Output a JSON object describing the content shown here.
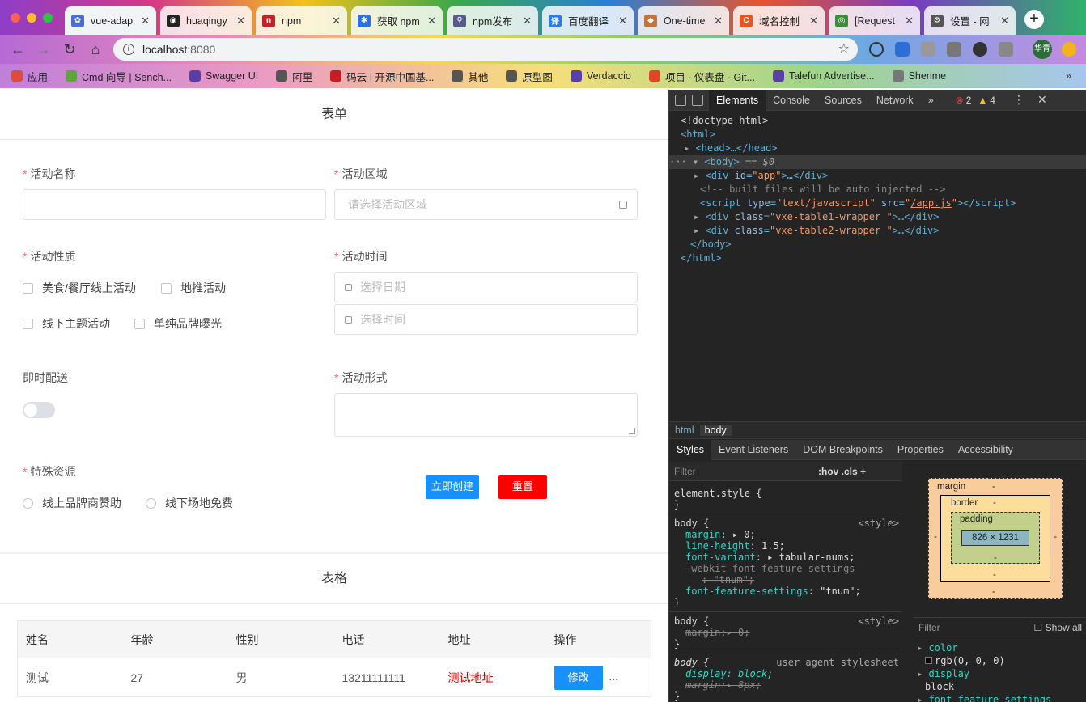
{
  "browser": {
    "tabs": [
      {
        "title": "vue-adap",
        "color": "#4b6cd6",
        "glyph": "✿",
        "active": true
      },
      {
        "title": "huaqingy",
        "color": "#222222",
        "glyph": "◉"
      },
      {
        "title": "npm",
        "color": "#c12127",
        "glyph": "n"
      },
      {
        "title": "获取 npm",
        "color": "#2f6fdb",
        "glyph": "✱"
      },
      {
        "title": "npm发布",
        "color": "#5a5a8a",
        "glyph": "⚲"
      },
      {
        "title": "百度翻译",
        "color": "#2b7be8",
        "glyph": "译"
      },
      {
        "title": "One-time",
        "color": "#c2743a",
        "glyph": "◆"
      },
      {
        "title": "域名控制",
        "color": "#e8531e",
        "glyph": "C"
      },
      {
        "title": "[Request",
        "color": "#3a8e3a",
        "glyph": "◎"
      },
      {
        "title": "设置 - 网",
        "color": "#555555",
        "glyph": "⚙"
      }
    ],
    "new_tab_label": "+",
    "url_host": "localhost",
    "url_port": ":8080",
    "profile_label": "华青",
    "bookmarks": [
      {
        "label": "应用",
        "color": "#e04a3a"
      },
      {
        "label": "Cmd 向导 | Sench...",
        "color": "#5da63a"
      },
      {
        "label": "Swagger UI",
        "color": "#5b3fa8"
      },
      {
        "label": "阿里",
        "color": "#555555"
      },
      {
        "label": "码云 | 开源中国基...",
        "color": "#c71d23"
      },
      {
        "label": "其他",
        "color": "#555555"
      },
      {
        "label": "原型图",
        "color": "#555555"
      },
      {
        "label": "Verdaccio",
        "color": "#5b3fa8"
      },
      {
        "label": "项目 · 仪表盘 · Git...",
        "color": "#e2432a"
      },
      {
        "label": "Talefun Advertise...",
        "color": "#5b3fa8"
      },
      {
        "label": "Shenme",
        "color": "#777777"
      }
    ]
  },
  "form": {
    "title": "表单",
    "activity_name_label": "活动名称",
    "activity_region_label": "活动区域",
    "activity_region_placeholder": "请选择活动区域",
    "activity_type_label": "活动性质",
    "activity_type_options": [
      "美食/餐厅线上活动",
      "地推活动",
      "线下主题活动",
      "单纯品牌曝光"
    ],
    "activity_time_label": "活动时间",
    "date_placeholder": "选择日期",
    "time_placeholder": "选择时间",
    "instant_delivery_label": "即时配送",
    "activity_form_label": "活动形式",
    "special_resource_label": "特殊资源",
    "special_resource_options": [
      "线上品牌商赞助",
      "线下场地免费"
    ],
    "create_button": "立即创建",
    "reset_button": "重置",
    "create_color": "#1890ff",
    "reset_color": "#ff0000"
  },
  "table": {
    "title": "表格",
    "columns": [
      "姓名",
      "年龄",
      "性别",
      "电话",
      "地址",
      "操作"
    ],
    "rows": [
      {
        "name": "测试",
        "age": "27",
        "gender": "男",
        "phone": "13211111111",
        "address": "测试地址",
        "edit_label": "修改",
        "more": "..."
      }
    ],
    "address_color": "#cc0000"
  },
  "devtools": {
    "tabs": [
      "Elements",
      "Console",
      "Sources",
      "Network",
      "»"
    ],
    "errors": "2",
    "warnings": "4",
    "dom": {
      "doctype": "<!doctype html>",
      "html_open": "<html>",
      "head": "<head>…</head>",
      "body_open": "<body>",
      "body_marker": "== $0",
      "div_app_tag": "div",
      "div_app_id": "app",
      "comment": "<!-- built files will be auto injected -->",
      "script_type": "text/javascript",
      "script_src": "/app.js",
      "wrapper1": "vxe-table1-wrapper ",
      "wrapper2": "vxe-table2-wrapper ",
      "body_close": "</body>",
      "html_close": "</html>"
    },
    "breadcrumbs": [
      "html",
      "body"
    ],
    "subtabs": [
      "Styles",
      "Event Listeners",
      "DOM Breakpoints",
      "Properties",
      "Accessibility"
    ],
    "filter_placeholder": "Filter",
    "filter_opts": ":hov  .cls  +",
    "element_style": "element.style {",
    "rule1_selector": "body {",
    "rule1_source": "<style>",
    "rule1_props": [
      {
        "name": "margin",
        "value": "▸ 0;"
      },
      {
        "name": "line-height",
        "value": "1.5;"
      },
      {
        "name": "font-variant",
        "value": "▸ tabular-nums;"
      },
      {
        "name": "-webkit-font-feature-settings",
        "value": ""
      },
      {
        "name": "",
        "value": ": \"tnum\";"
      },
      {
        "name": "font-feature-settings",
        "value": "\"tnum\";"
      }
    ],
    "rule2_selector": "body {",
    "rule2_source": "<style>",
    "rule2_prop": "margin:▸ 0;",
    "rule3_selector": "body {",
    "rule3_source": "user agent stylesheet",
    "rule3_props": [
      "display: block;",
      "margin:▸ 8px;"
    ],
    "box_model": {
      "margin_label": "margin",
      "border_label": "border",
      "padding_label": "padding",
      "content": "826 × 1231",
      "dash": "-"
    },
    "computed_filter": "Filter",
    "show_all": "Show all",
    "computed": [
      {
        "name": "color",
        "value": "rgb(0, 0, 0)"
      },
      {
        "name": "display",
        "value": "block"
      },
      {
        "name": "font-feature-settings",
        "value": ""
      }
    ]
  }
}
